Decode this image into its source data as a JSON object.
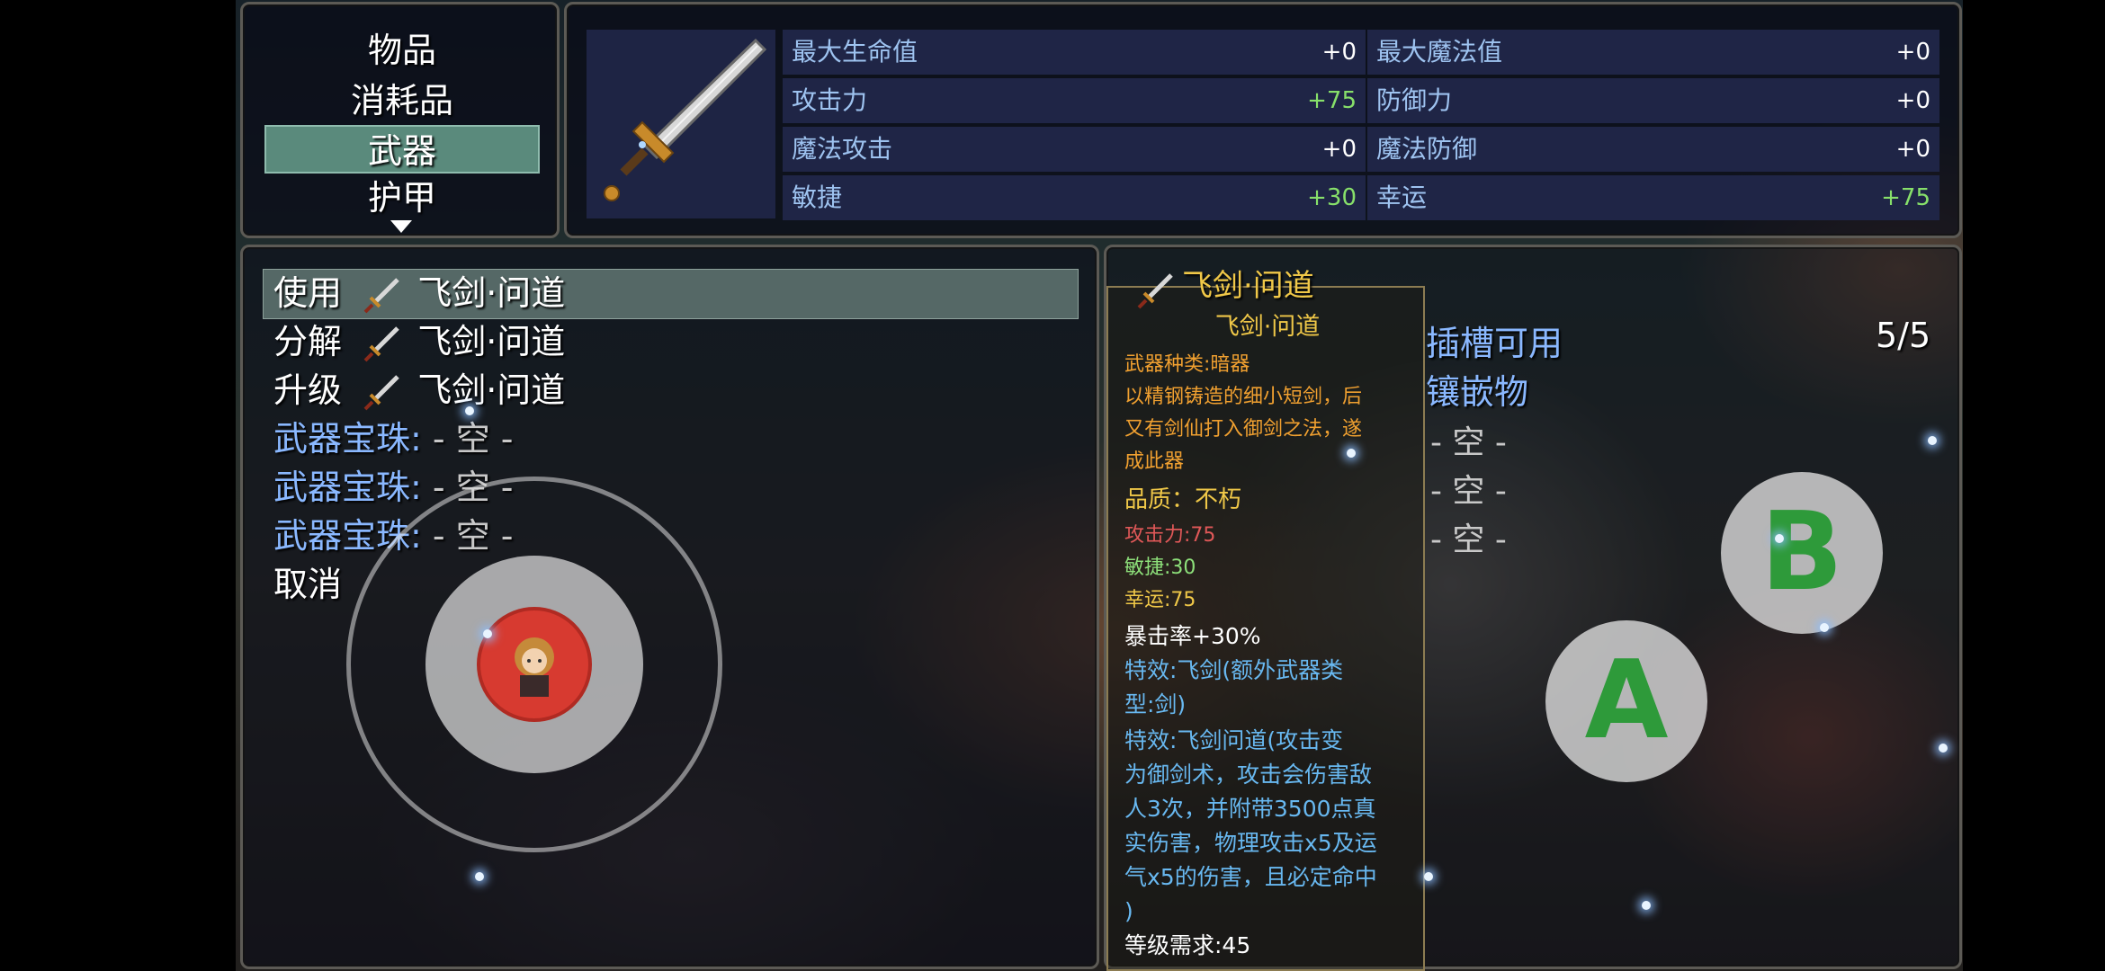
{
  "categories": {
    "items": [
      "物品",
      "消耗品",
      "武器",
      "护甲"
    ],
    "selected_index": 2
  },
  "stats": [
    {
      "name": "最大生命值",
      "value": "+0",
      "positive": false
    },
    {
      "name": "最大魔法值",
      "value": "+0",
      "positive": false
    },
    {
      "name": "攻击力",
      "value": "+75",
      "positive": true
    },
    {
      "name": "防御力",
      "value": "+0",
      "positive": false
    },
    {
      "name": "魔法攻击",
      "value": "+0",
      "positive": false
    },
    {
      "name": "魔法防御",
      "value": "+0",
      "positive": false
    },
    {
      "name": "敏捷",
      "value": "+30",
      "positive": true
    },
    {
      "name": "幸运",
      "value": "+75",
      "positive": true
    }
  ],
  "commands": {
    "use": "使用",
    "decompose": "分解",
    "upgrade": "升级",
    "item_name": "飞剑·问道",
    "gem_label": "武器宝珠:",
    "empty": "- 空 -",
    "cancel": "取消"
  },
  "tooltip": {
    "title": "飞剑·问道",
    "subtitle": "飞剑·问道",
    "weapon_type": "武器种类:暗器",
    "desc_1": "以精钢铸造的细小短剑，后",
    "desc_2": "又有剑仙打入御剑之法，遂",
    "desc_3": "成此器",
    "quality": "品质：不朽",
    "atk": "攻击力:75",
    "agi": "敏捷:30",
    "luck": "幸运:75",
    "crit": "暴击率+30%",
    "effect1_a": "特效:飞剑(额外武器类",
    "effect1_b": "型:剑)",
    "effect2_a": "特效:飞剑问道(攻击变",
    "effect2_b": "为御剑术，攻击会伤害敌",
    "effect2_c": "人3次，并附带3500点真",
    "effect2_d": "实伤害，物理攻击x5及运",
    "effect2_e": "气x5的伤害，且必定命中",
    "effect2_f": ")",
    "level_req": "等级需求:45"
  },
  "slots": {
    "available_label": "插槽可用",
    "available_count": "5/5",
    "inlay_label": "镶嵌物",
    "empty": "- 空 -"
  },
  "controls": {
    "button_a": "A",
    "button_b": "B"
  },
  "colors": {
    "highlight": "#5a8a7c",
    "stat_positive": "#87e06a",
    "gem_label": "#8ab8ff",
    "tooltip_title": "#f0c848"
  }
}
